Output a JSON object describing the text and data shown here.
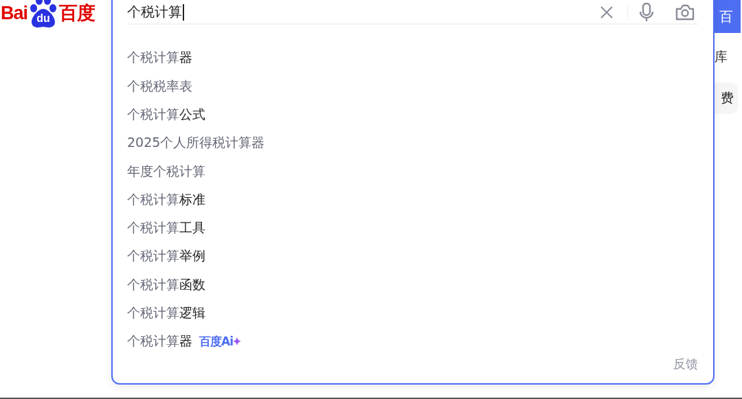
{
  "logo": {
    "left": "Bai",
    "paw": "du",
    "right": "百度"
  },
  "search": {
    "value": "个税计算",
    "focused": true
  },
  "suggestions": [
    {
      "kind": "plain",
      "typed": "个税计算",
      "completion": "器"
    },
    {
      "kind": "plain",
      "typed": "个税税率表"
    },
    {
      "kind": "plain",
      "typed": "个税计算",
      "completion": "公式"
    },
    {
      "kind": "plain",
      "typed": "2025个人所得税计算器"
    },
    {
      "kind": "plain",
      "typed": "年度个税计算"
    },
    {
      "kind": "plain",
      "typed": "个税计算",
      "completion": "标准"
    },
    {
      "kind": "plain",
      "typed": "个税计算",
      "completion": "工具"
    },
    {
      "kind": "plain",
      "typed": "个税计算",
      "completion": "举例"
    },
    {
      "kind": "plain",
      "typed": "个税计算",
      "completion": "函数"
    },
    {
      "kind": "plain",
      "typed": "个税计算",
      "completion": "逻辑"
    },
    {
      "kind": "ai",
      "typed": "个税计算",
      "completion": "器",
      "badge": "百度Ai"
    }
  ],
  "feedback": "反馈",
  "search_button": "百",
  "side": {
    "link": "库",
    "pill": "费"
  }
}
